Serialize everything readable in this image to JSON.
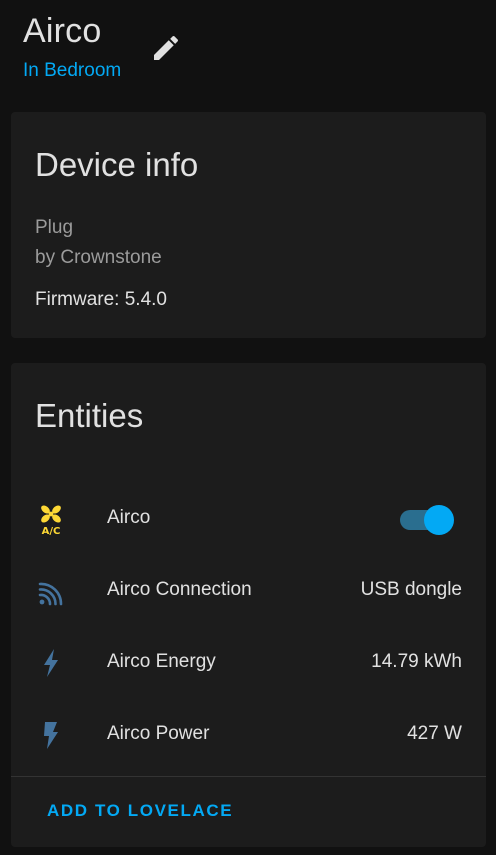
{
  "header": {
    "device_name": "Airco",
    "area_link": "In Bedroom",
    "edit_icon": "pencil-icon"
  },
  "device_info": {
    "title": "Device info",
    "model": "Plug",
    "manufacturer": "by Crownstone",
    "firmware": "Firmware: 5.4.0"
  },
  "entities": {
    "title": "Entities",
    "rows": [
      {
        "icon": "air-conditioner-icon",
        "name": "Airco",
        "state": "on",
        "kind": "toggle"
      },
      {
        "icon": "signal-connection-icon",
        "name": "Airco Connection",
        "state": "USB dongle",
        "kind": "sensor"
      },
      {
        "icon": "energy-flash-outline-icon",
        "name": "Airco Energy",
        "state": "14.79 kWh",
        "kind": "sensor"
      },
      {
        "icon": "power-flash-icon",
        "name": "Airco Power",
        "state": "427 W",
        "kind": "sensor"
      }
    ],
    "add_button": "ADD TO LOVELACE"
  },
  "colors": {
    "accent": "#03a9f4",
    "icon_yellow": "#fdd835",
    "icon_blue": "#44739e",
    "card_bg": "#1c1c1c",
    "page_bg": "#111111"
  }
}
